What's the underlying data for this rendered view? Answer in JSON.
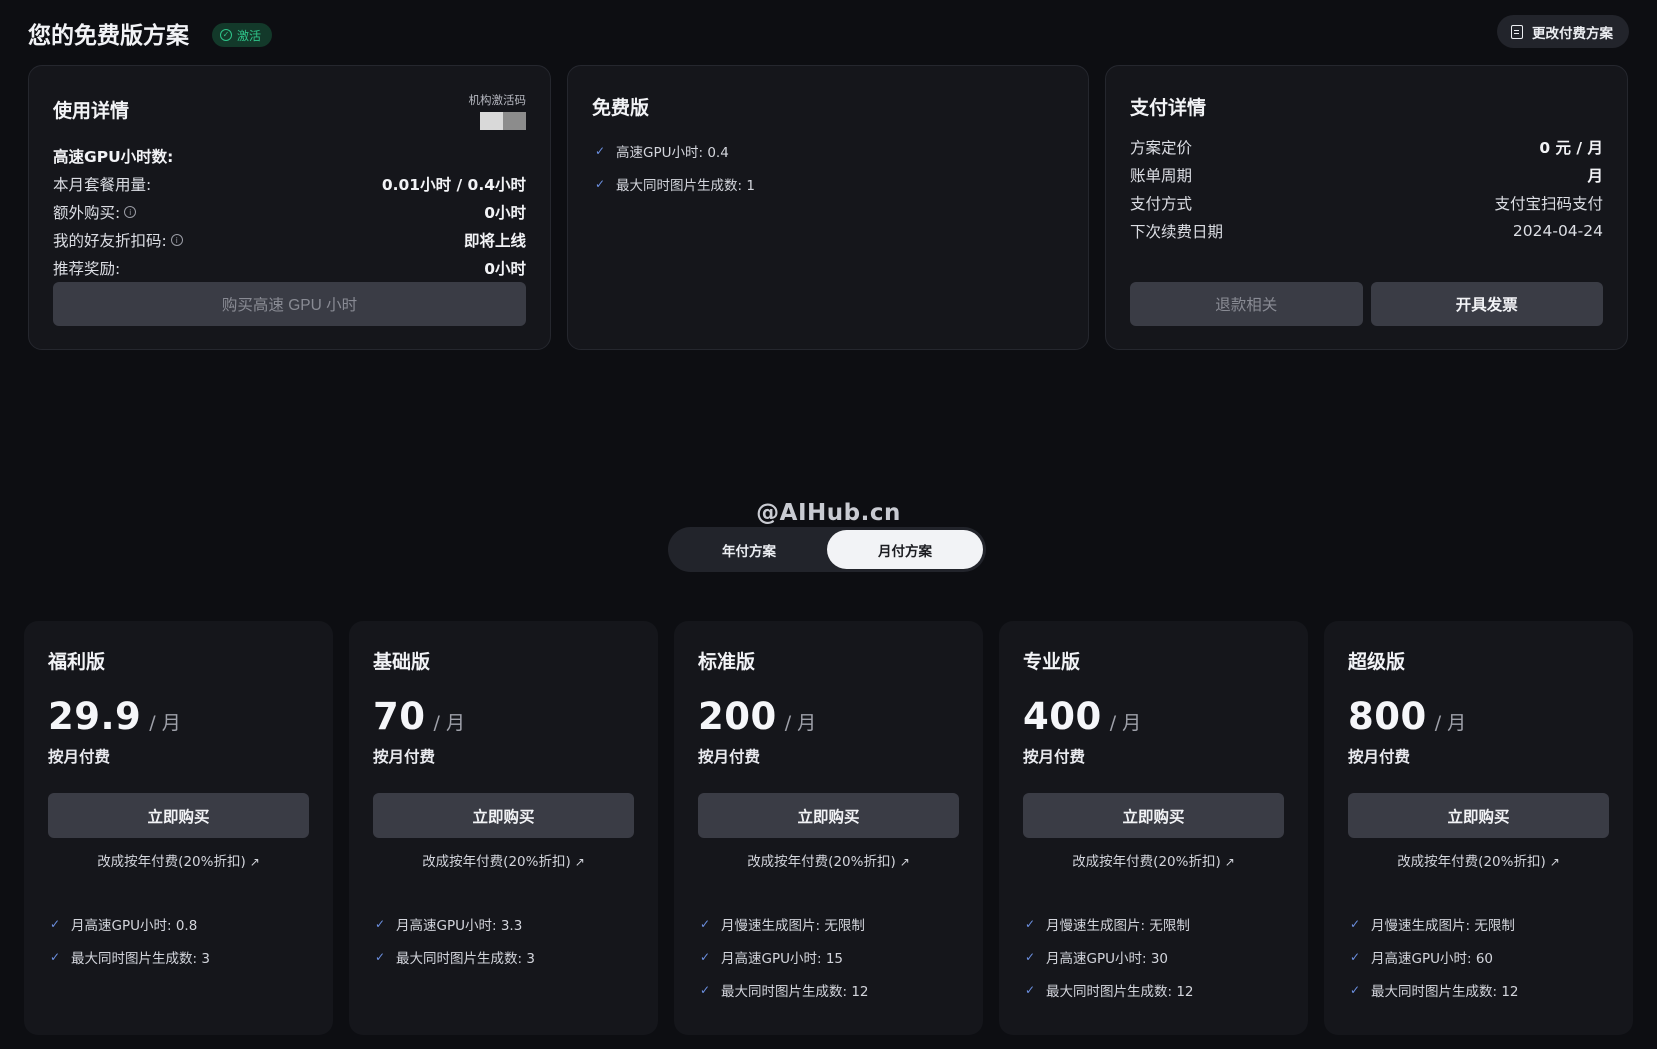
{
  "header": {
    "title": "您的免费版方案",
    "status_badge": "激活",
    "change_plan_label": "更改付费方案"
  },
  "usage": {
    "title": "使用详情",
    "org_code_label": "机构激活码",
    "rows": [
      {
        "label": "高速GPU小时数:",
        "value": ""
      },
      {
        "label": "本月套餐用量:",
        "value": "0.01小时 / 0.4小时"
      },
      {
        "label": "额外购买:",
        "value": "0小时"
      },
      {
        "label": "我的好友折扣码:",
        "value": "即将上线"
      },
      {
        "label": "推荐奖励:",
        "value": "0小时"
      }
    ],
    "buy_gpu_label": "购买高速 GPU 小时"
  },
  "free_plan": {
    "title": "免费版",
    "features": [
      "高速GPU小时: 0.4",
      "最大同时图片生成数: 1"
    ]
  },
  "payment": {
    "title": "支付详情",
    "rows": [
      {
        "label": "方案定价",
        "value": "0 元 / 月"
      },
      {
        "label": "账单周期",
        "value": "月"
      },
      {
        "label": "支付方式",
        "value": "支付宝扫码支付"
      },
      {
        "label": "下次续费日期",
        "value": "2024-04-24"
      }
    ],
    "refund_label": "退款相关",
    "invoice_label": "开具发票"
  },
  "watermark": "@AIHub.cn",
  "billing_toggle": {
    "annual": "年付方案",
    "monthly": "月付方案",
    "selected": "monthly"
  },
  "plans": [
    {
      "name": "福利版",
      "price": "29.9",
      "unit": "/ 月",
      "billing": "按月付费",
      "buy_label": "立即购买",
      "switch_label": "改成按年付费(20%折扣)",
      "features": [
        "月高速GPU小时: 0.8",
        "最大同时图片生成数: 3"
      ]
    },
    {
      "name": "基础版",
      "price": "70",
      "unit": "/ 月",
      "billing": "按月付费",
      "buy_label": "立即购买",
      "switch_label": "改成按年付费(20%折扣)",
      "features": [
        "月高速GPU小时: 3.3",
        "最大同时图片生成数: 3"
      ]
    },
    {
      "name": "标准版",
      "price": "200",
      "unit": "/ 月",
      "billing": "按月付费",
      "buy_label": "立即购买",
      "switch_label": "改成按年付费(20%折扣)",
      "features": [
        "月慢速生成图片: 无限制",
        "月高速GPU小时: 15",
        "最大同时图片生成数: 12"
      ]
    },
    {
      "name": "专业版",
      "price": "400",
      "unit": "/ 月",
      "billing": "按月付费",
      "buy_label": "立即购买",
      "switch_label": "改成按年付费(20%折扣)",
      "features": [
        "月慢速生成图片: 无限制",
        "月高速GPU小时: 30",
        "最大同时图片生成数: 12"
      ]
    },
    {
      "name": "超级版",
      "price": "800",
      "unit": "/ 月",
      "billing": "按月付费",
      "buy_label": "立即购买",
      "switch_label": "改成按年付费(20%折扣)",
      "features": [
        "月慢速生成图片: 无限制",
        "月高速GPU小时: 60",
        "最大同时图片生成数: 12"
      ]
    }
  ],
  "icons": {
    "check": "check-icon",
    "info": "info-icon",
    "arrow": "arrow-up-right-icon",
    "doc": "document-icon"
  },
  "colors": {
    "background": "#0d0e12",
    "card": "#15161b",
    "button": "#3a3c45",
    "badge_green": "#2fc48a",
    "check_blue": "#6b8fe0"
  }
}
